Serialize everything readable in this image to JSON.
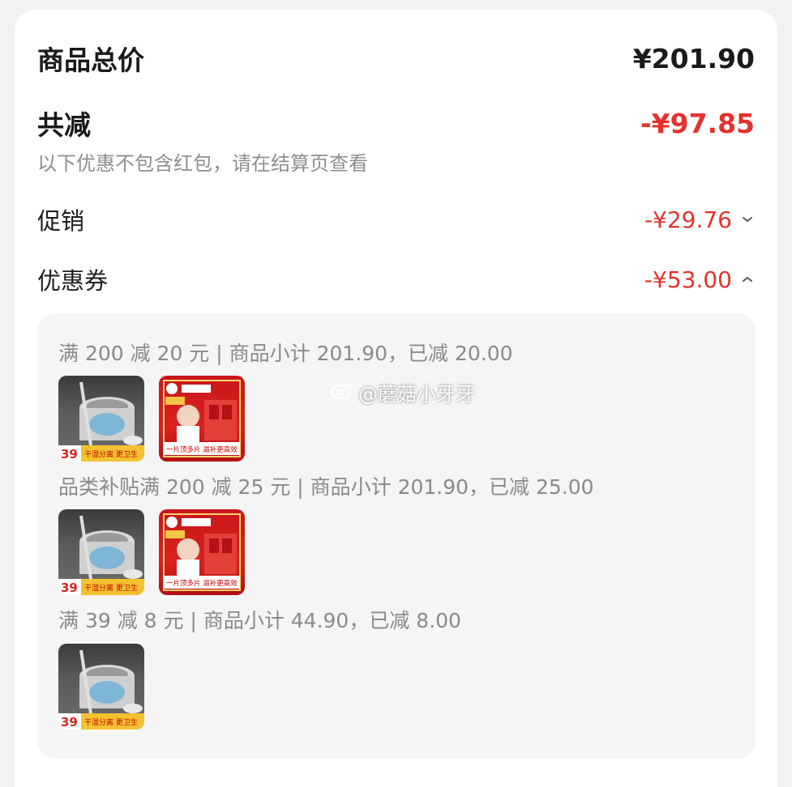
{
  "summary": {
    "total_label": "商品总价",
    "total_amount": "¥201.90",
    "reduce_label": "共减",
    "reduce_amount": "-¥97.85",
    "note": "以下优惠不包含红包，请在结算页查看"
  },
  "promotion": {
    "label": "促销",
    "amount": "-¥29.76",
    "state": "collapsed",
    "icon": "chevron-down-icon"
  },
  "coupon": {
    "label": "优惠券",
    "amount": "-¥53.00",
    "state": "expanded",
    "icon": "chevron-up-icon"
  },
  "coupon_details": [
    {
      "text": "满 200 减 20 元 | 商品小计 201.90，已减 20.00",
      "products": [
        "mop-bucket",
        "supplement-box"
      ]
    },
    {
      "text": "品类补贴满 200 减 25 元 | 商品小计 201.90，已减 25.00",
      "products": [
        "mop-bucket",
        "supplement-box"
      ]
    },
    {
      "text": "满 39 减 8 元 | 商品小计 44.90，已减 8.00",
      "products": [
        "mop-bucket"
      ]
    }
  ],
  "product_images": {
    "mop-bucket": {
      "price_tag": "39",
      "caption": "干湿分离 更卫生"
    },
    "supplement-box": {
      "caption": "一片顶多片  滋补更高效"
    }
  },
  "watermark": "@蘑菇小牙牙",
  "colors": {
    "accent_red": "#e6312c",
    "panel_bg": "#f5f5f5"
  }
}
